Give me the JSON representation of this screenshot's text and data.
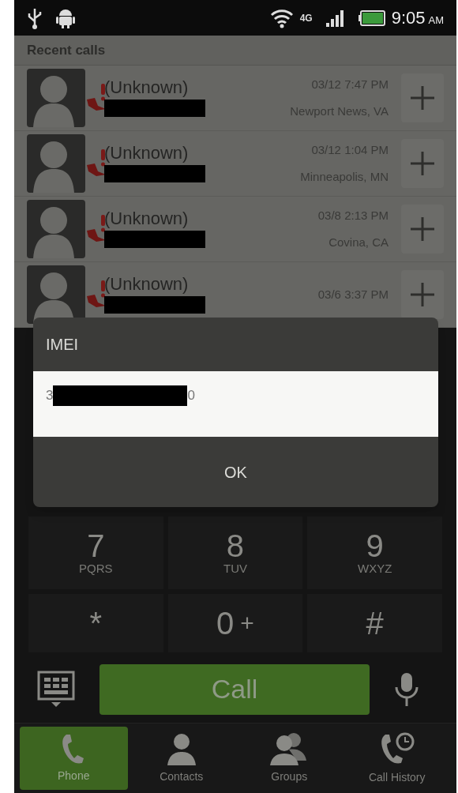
{
  "status_bar": {
    "time": "9:05",
    "ampm": "AM",
    "network": "4G"
  },
  "header": "Recent calls",
  "calls": [
    {
      "name": "(Unknown)",
      "time": "03/12 7:47 PM",
      "location": "Newport News, VA"
    },
    {
      "name": "(Unknown)",
      "time": "03/12 1:04 PM",
      "location": "Minneapolis, MN"
    },
    {
      "name": "(Unknown)",
      "time": "03/8 2:13 PM",
      "location": "Covina, CA"
    },
    {
      "name": "(Unknown)",
      "time": "03/6 3:37 PM"
    }
  ],
  "dialog": {
    "title": "IMEI",
    "value_start": "3",
    "value_end": "0",
    "button": "OK"
  },
  "keypad": [
    {
      "digit": "7",
      "letters": "PQRS"
    },
    {
      "digit": "8",
      "letters": "TUV"
    },
    {
      "digit": "9",
      "letters": "WXYZ"
    },
    {
      "digit": "*"
    },
    {
      "digit": "0",
      "extra": "+"
    },
    {
      "digit": "#"
    }
  ],
  "call_button": "Call",
  "tabs": [
    {
      "label": "Phone",
      "kind": "phone",
      "selected": true
    },
    {
      "label": "Contacts",
      "kind": "contacts",
      "selected": false
    },
    {
      "label": "Groups",
      "kind": "groups",
      "selected": false
    },
    {
      "label": "Call History",
      "kind": "history",
      "selected": false
    }
  ]
}
